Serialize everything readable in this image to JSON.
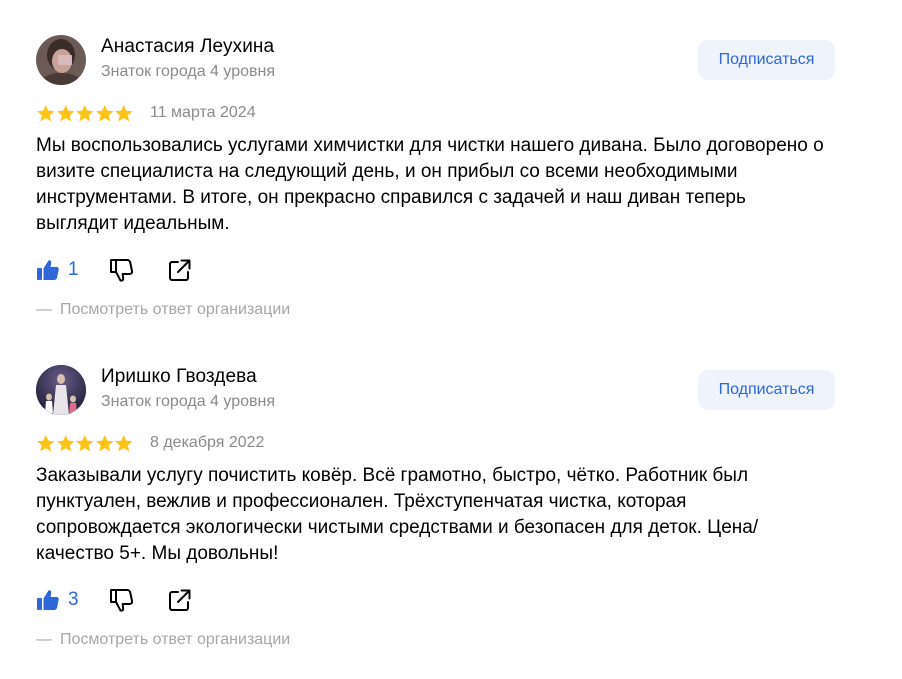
{
  "subscribe_label": "Подписаться",
  "org_reply_dash": "—",
  "org_reply_label": "Посмотреть ответ организации",
  "colors": {
    "accent_blue": "#2f67d9",
    "button_bg": "#eef3fc",
    "star_yellow": "#fcc419",
    "muted_text": "#8a8a8a"
  },
  "reviews": [
    {
      "author": "Анастасия Леухина",
      "level": "Знаток города 4 уровня",
      "rating": 5,
      "date": "11 марта 2024",
      "text": "Мы воспользовались услугами химчистки для чистки нашего дивана. Было договорено о визите специалиста на следующий день, и он прибыл со всеми необходимыми инструментами. В итоге, он прекрасно справился с задачей и наш диван теперь выглядит идеальным.",
      "likes": "1"
    },
    {
      "author": "Иришко Гвоздева",
      "level": "Знаток города 4 уровня",
      "rating": 5,
      "date": "8 декабря 2022",
      "text": "Заказывали услугу почистить ковёр. Всё грамотно, быстро, чётко. Работник был пунктуален, вежлив и профессионален. Трёхступенчатая чистка, которая сопровождается экологически чистыми средствами и безопасен для деток. Цена/качество 5+. Мы довольны!",
      "likes": "3"
    }
  ]
}
